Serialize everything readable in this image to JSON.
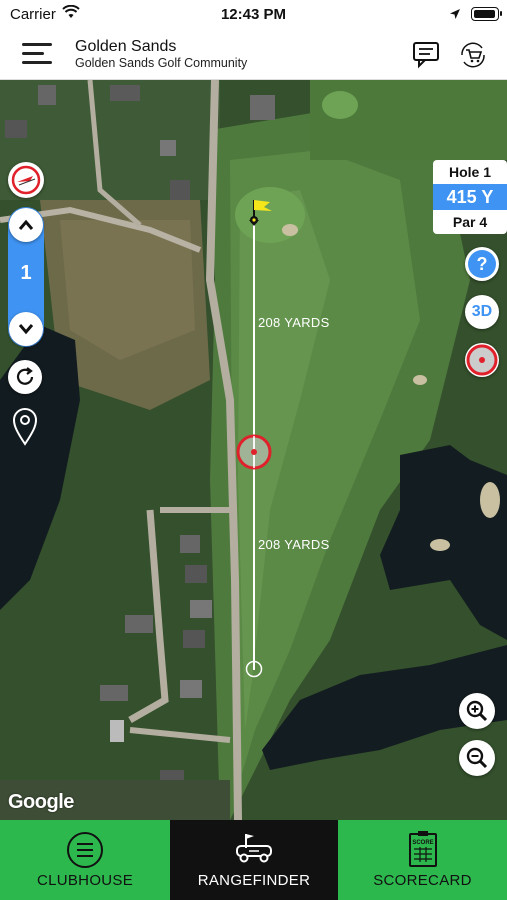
{
  "status": {
    "carrier": "Carrier",
    "time": "12:43 PM"
  },
  "header": {
    "title": "Golden Sands",
    "subtitle": "Golden Sands Golf Community"
  },
  "hole": {
    "label": "Hole 1",
    "yardage": "415 Y",
    "par": "Par 4",
    "current": "1"
  },
  "map": {
    "distance_upper": "208 YARDS",
    "distance_lower": "208 YARDS",
    "attribution": "Google",
    "view_3d": "3D",
    "help": "?"
  },
  "nav": {
    "clubhouse": "CLUBHOUSE",
    "rangefinder": "RANGEFINDER",
    "scorecard": "SCORECARD",
    "score_icon_text": "SCORE"
  },
  "colors": {
    "accent_blue": "#3f93f2",
    "nav_green": "#2db84d",
    "target_red": "#e0212b",
    "flag_yellow": "#f5e51b"
  }
}
